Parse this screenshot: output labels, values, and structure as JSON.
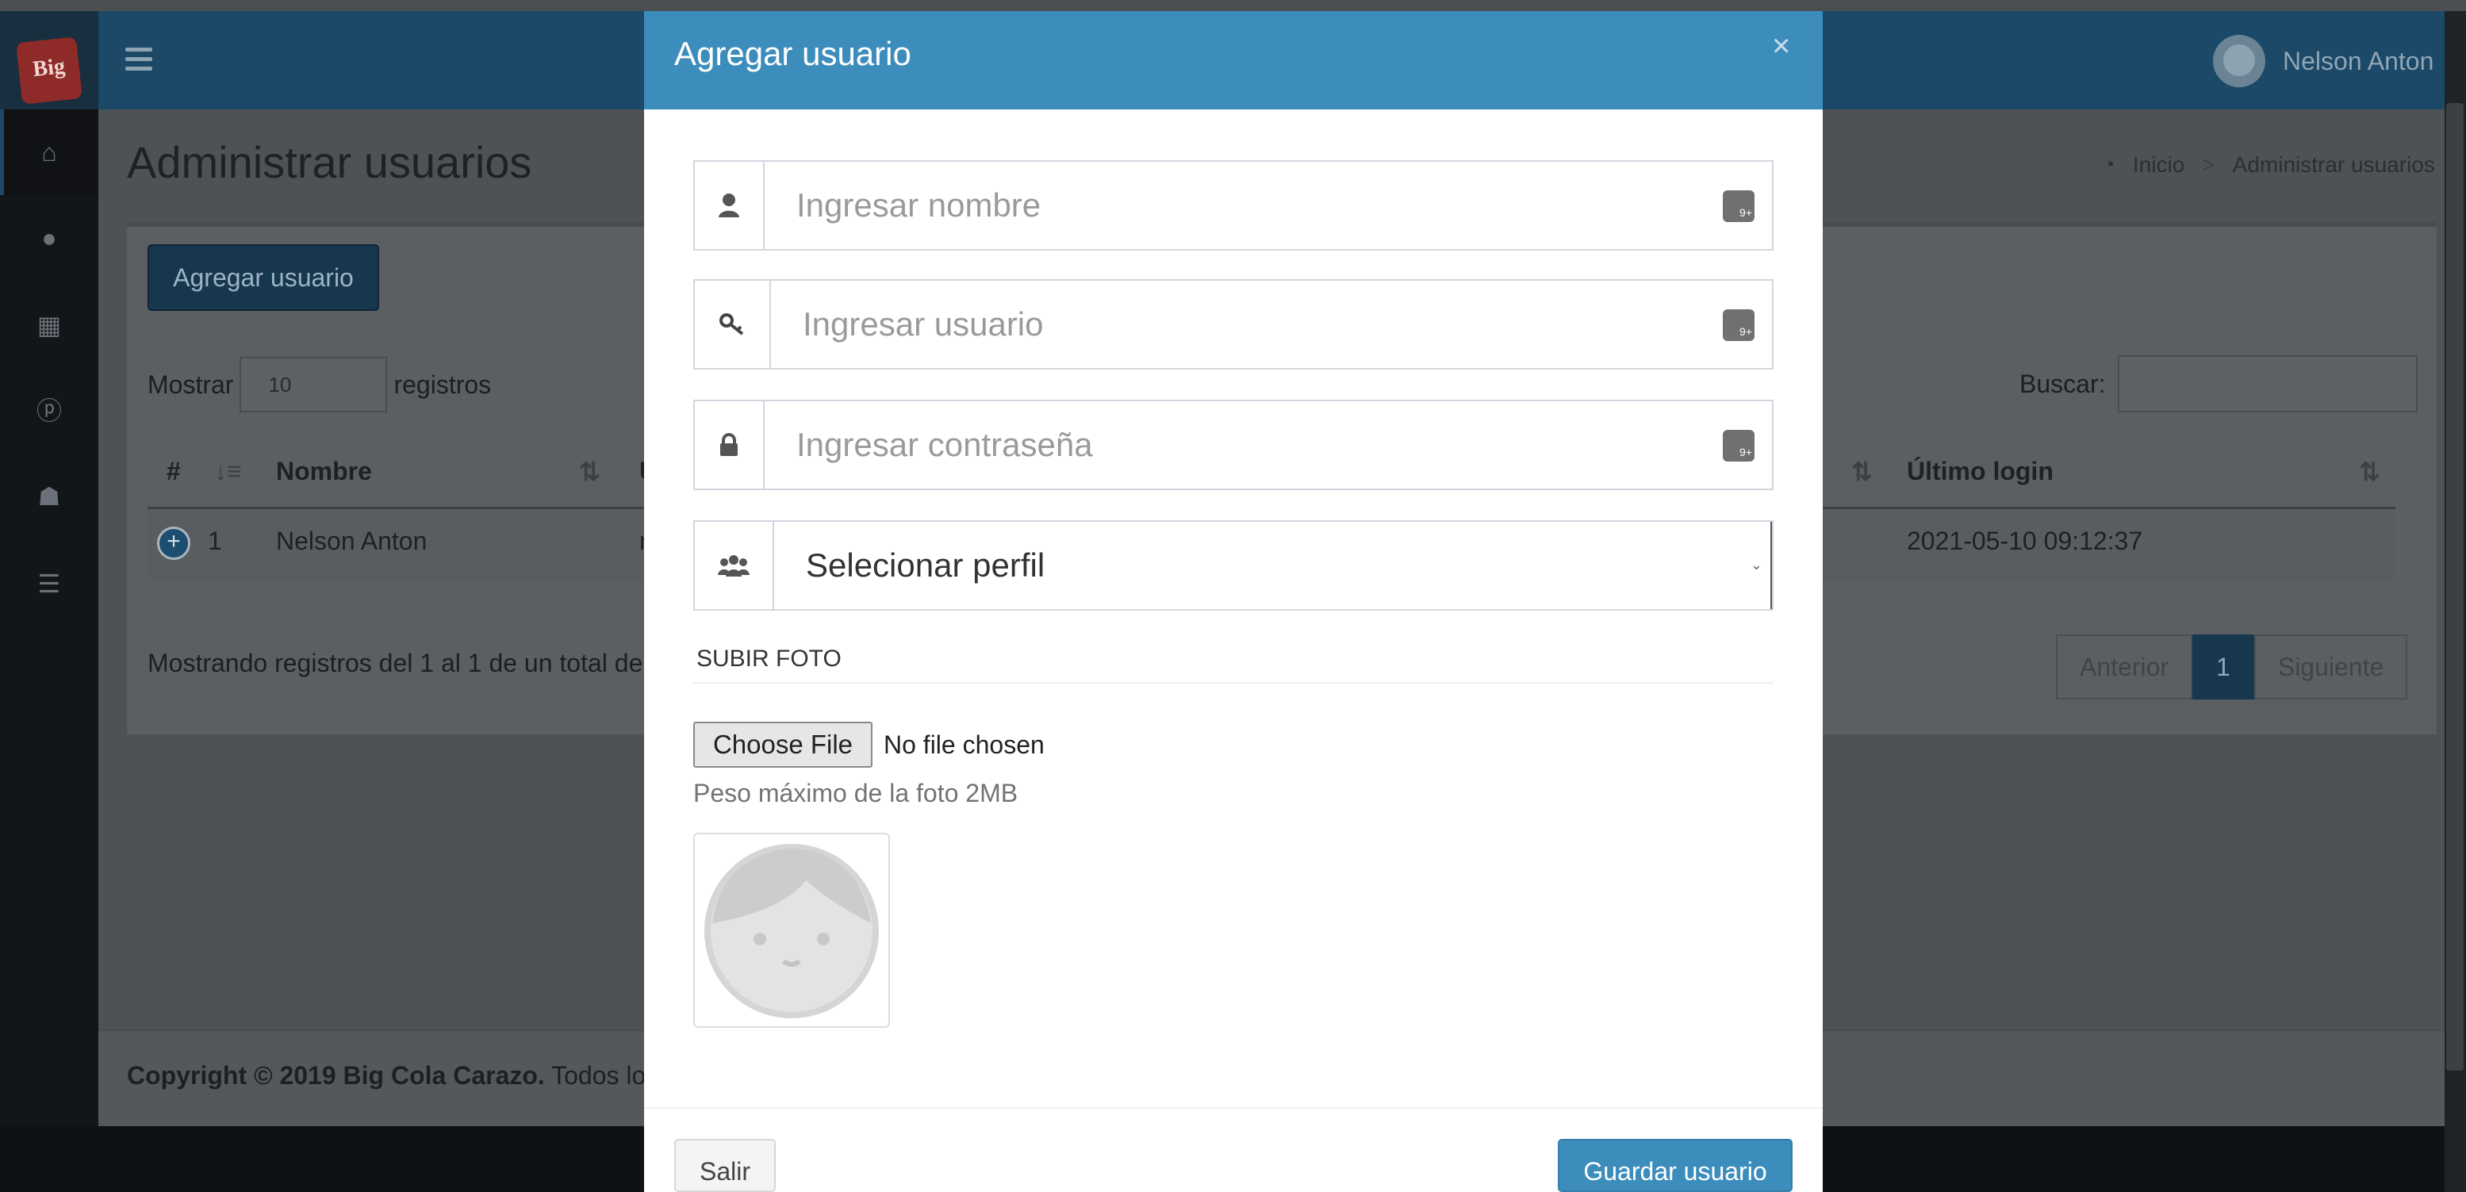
{
  "app": {
    "logo_text": "Big",
    "user_name": "Nelson Anton"
  },
  "page": {
    "title": "Administrar usuarios",
    "breadcrumb": [
      "Inicio",
      ">",
      "Administrar usuarios"
    ]
  },
  "sidebar": {
    "icons": [
      "home-icon",
      "user-icon",
      "grid-icon",
      "product-icon",
      "users-icon",
      "list-icon"
    ]
  },
  "toolbar": {
    "add_label": "Agregar usuario",
    "show_label": "Mostrar",
    "show_value": "10",
    "records_label": "registros",
    "search_label": "Buscar:"
  },
  "table": {
    "headers": [
      "#",
      "Nombre",
      "U",
      "Último login"
    ],
    "rows": [
      {
        "index": "1",
        "name": "Nelson Anton",
        "col3": "n",
        "last_login": "2021-05-10 09:12:37"
      }
    ],
    "info": "Mostrando registros del 1 al 1 de un total de"
  },
  "pager": {
    "prev": "Anterior",
    "current": "1",
    "next": "Siguiente"
  },
  "footer": {
    "bold": "Copyright © 2019 Big Cola Carazo.",
    "rest": "Todos los"
  },
  "modal": {
    "title": "Agregar usuario",
    "close": "×",
    "fields": {
      "name_placeholder": "Ingresar nombre",
      "user_placeholder": "Ingresar usuario",
      "password_placeholder": "Ingresar contraseña",
      "profile_selected": "Selecionar perfil"
    },
    "upload_title": "SUBIR FOTO",
    "file_button": "Choose File",
    "file_status": "No file chosen",
    "max_size": "Peso máximo de la foto 2MB",
    "exit_label": "Salir",
    "save_label": "Guardar usuario"
  }
}
